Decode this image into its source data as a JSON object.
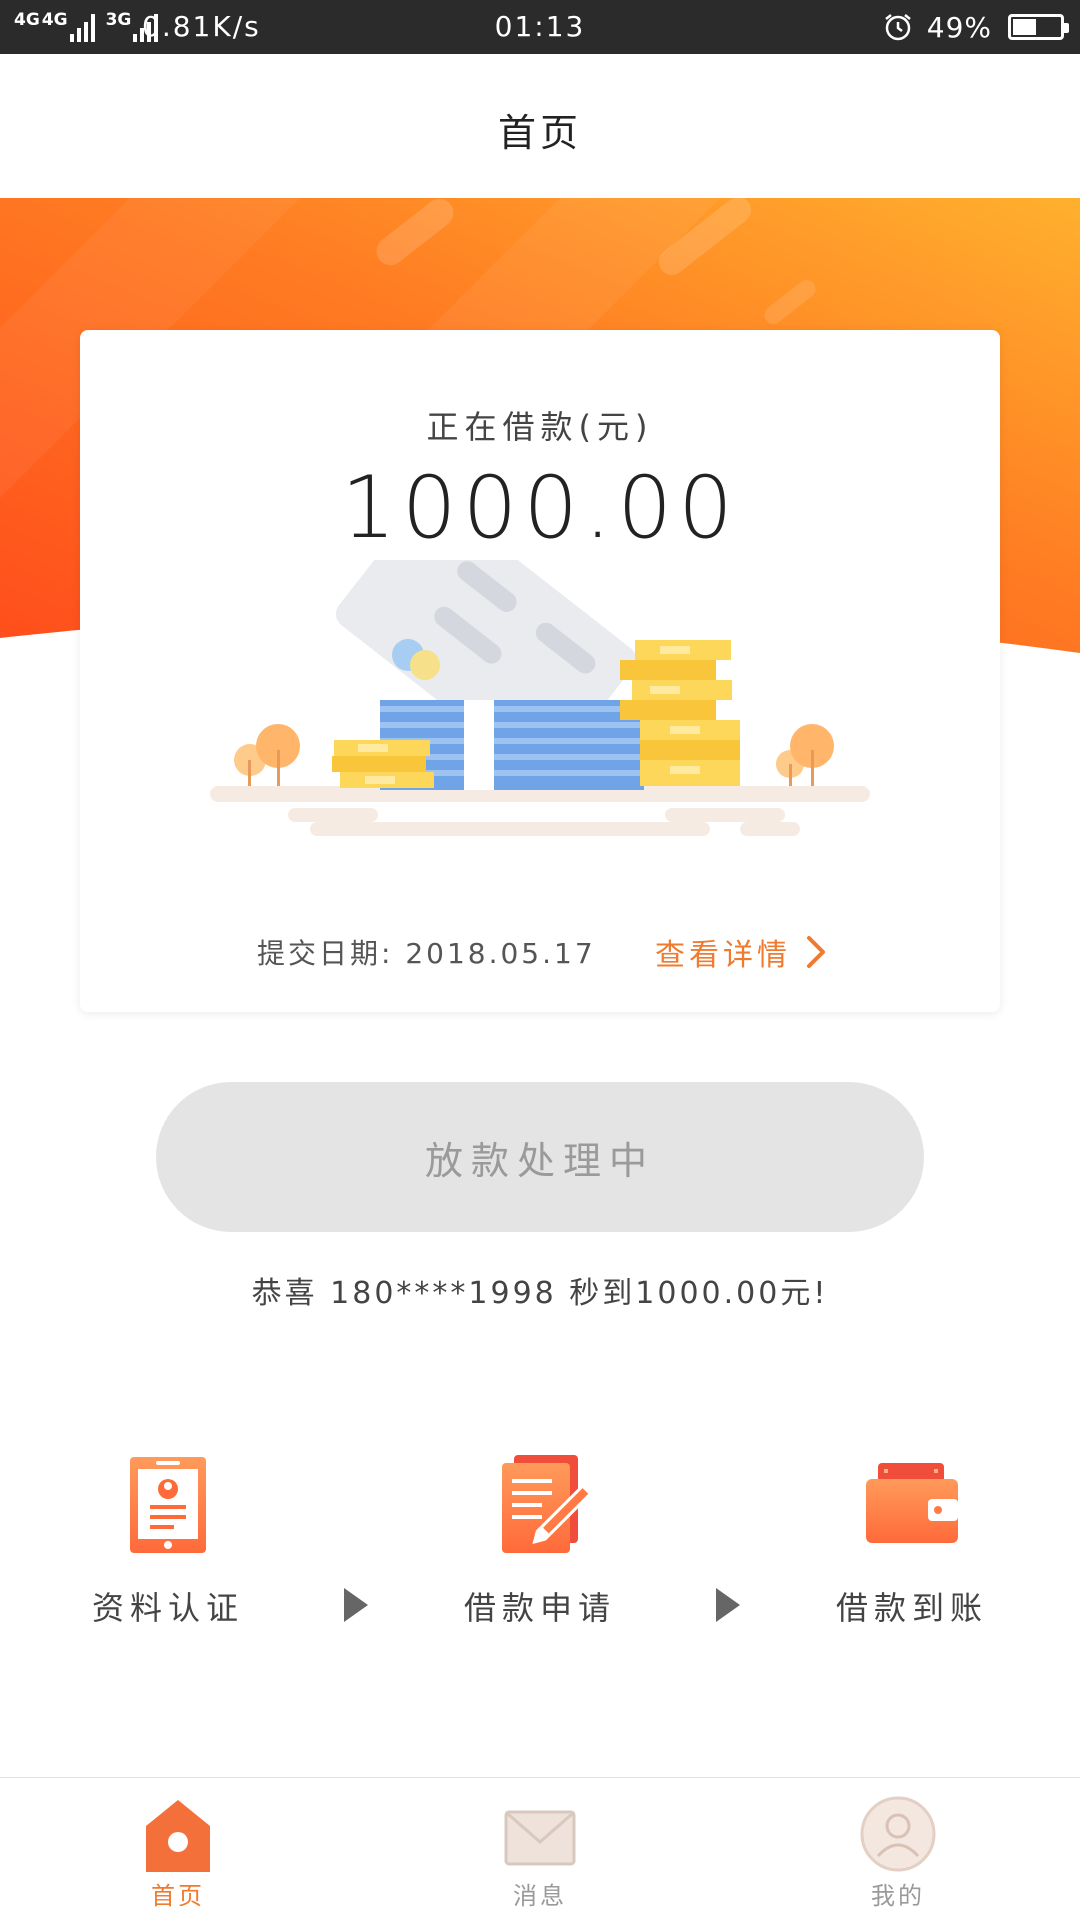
{
  "status_bar": {
    "network_1": "4G",
    "network_2": "4G",
    "network_3": "3G",
    "speed": "0.81K/s",
    "time": "01:13",
    "battery_percent": "49%",
    "battery_level": 0.49
  },
  "header": {
    "title": "首页"
  },
  "card": {
    "label": "正在借款(元)",
    "amount": "1000.00",
    "submit_date": "提交日期: 2018.05.17",
    "detail_link": "查看详情"
  },
  "status_button": {
    "label": "放款处理中"
  },
  "congrats": "恭喜 180****1998 秒到1000.00元!",
  "steps": [
    {
      "label": "资料认证",
      "icon": "profile-tablet-icon"
    },
    {
      "label": "借款申请",
      "icon": "document-pen-icon"
    },
    {
      "label": "借款到账",
      "icon": "wallet-icon"
    }
  ],
  "tabs": [
    {
      "label": "首页",
      "icon": "home-icon",
      "active": true
    },
    {
      "label": "消息",
      "icon": "envelope-icon",
      "active": false
    },
    {
      "label": "我的",
      "icon": "user-avatar-icon",
      "active": false
    }
  ],
  "colors": {
    "accent": "#f07a2e",
    "hero_start": "#ff5a1f",
    "hero_end": "#ffab2e",
    "pill": "#e4e4e4"
  }
}
